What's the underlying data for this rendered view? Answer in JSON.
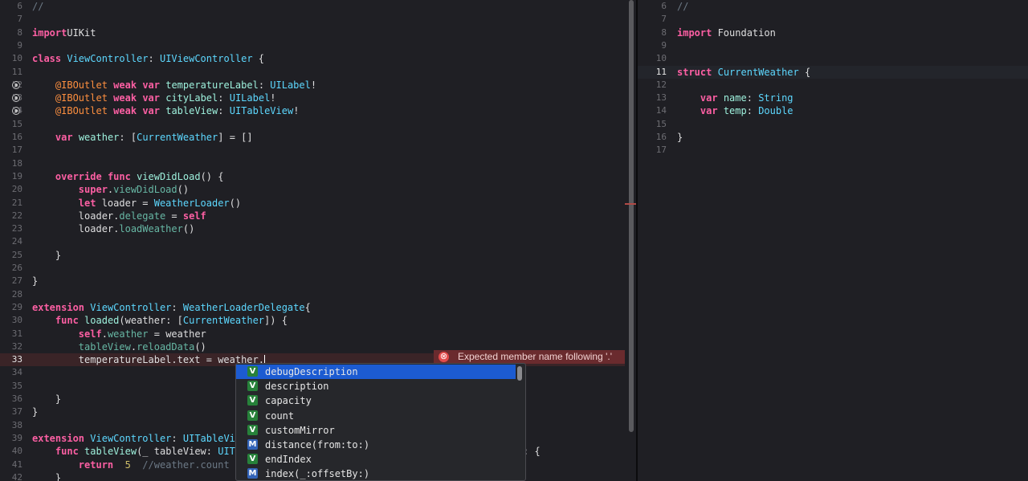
{
  "left_editor": {
    "lines": [
      {
        "n": "6",
        "seg": [
          [
            "cm",
            "//"
          ]
        ]
      },
      {
        "n": "7",
        "seg": []
      },
      {
        "n": "8",
        "seg": [
          [
            "kw",
            "import"
          ],
          [
            "",
            "UIKit"
          ]
        ]
      },
      {
        "n": "9",
        "seg": []
      },
      {
        "n": "10",
        "seg": [
          [
            "kw",
            "class"
          ],
          [
            "",
            ""
          ],
          [
            "tp",
            "ViewController"
          ],
          [
            "",
            ": "
          ],
          [
            "tp",
            "UIViewController"
          ],
          [
            "",
            " {"
          ]
        ]
      },
      {
        "n": "11",
        "seg": []
      },
      {
        "n": "12",
        "bp": true,
        "seg": [
          [
            "",
            "    "
          ],
          [
            "attr",
            "@IBOutlet"
          ],
          [
            "",
            " "
          ],
          [
            "kw",
            "weak"
          ],
          [
            "",
            " "
          ],
          [
            "kw",
            "var"
          ],
          [
            "",
            " "
          ],
          [
            "ut",
            "temperatureLabel"
          ],
          [
            "",
            ": "
          ],
          [
            "tp",
            "UILabel"
          ],
          [
            "",
            "!"
          ]
        ]
      },
      {
        "n": "13",
        "bp": true,
        "seg": [
          [
            "",
            "    "
          ],
          [
            "attr",
            "@IBOutlet"
          ],
          [
            "",
            " "
          ],
          [
            "kw",
            "weak"
          ],
          [
            "",
            " "
          ],
          [
            "kw",
            "var"
          ],
          [
            "",
            " "
          ],
          [
            "ut",
            "cityLabel"
          ],
          [
            "",
            ": "
          ],
          [
            "tp",
            "UILabel"
          ],
          [
            "",
            "!"
          ]
        ]
      },
      {
        "n": "14",
        "bp": true,
        "seg": [
          [
            "",
            "    "
          ],
          [
            "attr",
            "@IBOutlet"
          ],
          [
            "",
            " "
          ],
          [
            "kw",
            "weak"
          ],
          [
            "",
            " "
          ],
          [
            "kw",
            "var"
          ],
          [
            "",
            " "
          ],
          [
            "ut",
            "tableView"
          ],
          [
            "",
            ": "
          ],
          [
            "tp",
            "UITableView"
          ],
          [
            "",
            "!"
          ]
        ]
      },
      {
        "n": "15",
        "seg": []
      },
      {
        "n": "16",
        "seg": [
          [
            "",
            "    "
          ],
          [
            "kw",
            "var"
          ],
          [
            "",
            " "
          ],
          [
            "ut",
            "weather"
          ],
          [
            "",
            ": ["
          ],
          [
            "tp",
            "CurrentWeather"
          ],
          [
            "",
            "] = []"
          ]
        ]
      },
      {
        "n": "17",
        "seg": []
      },
      {
        "n": "18",
        "seg": []
      },
      {
        "n": "19",
        "seg": [
          [
            "",
            "    "
          ],
          [
            "kw",
            "override"
          ],
          [
            "",
            " "
          ],
          [
            "kw",
            "func"
          ],
          [
            "",
            " "
          ],
          [
            "ut",
            "viewDidLoad"
          ],
          [
            "",
            "() {"
          ]
        ]
      },
      {
        "n": "20",
        "seg": [
          [
            "",
            "        "
          ],
          [
            "kw",
            "super"
          ],
          [
            "",
            "."
          ],
          [
            "fn",
            "viewDidLoad"
          ],
          [
            "",
            "()"
          ]
        ]
      },
      {
        "n": "21",
        "seg": [
          [
            "",
            "        "
          ],
          [
            "kw",
            "let"
          ],
          [
            "",
            " loader = "
          ],
          [
            "tp",
            "WeatherLoader"
          ],
          [
            "",
            "()"
          ]
        ]
      },
      {
        "n": "22",
        "seg": [
          [
            "",
            "        loader."
          ],
          [
            "fn",
            "delegate"
          ],
          [
            "",
            " = "
          ],
          [
            "kw",
            "self"
          ]
        ]
      },
      {
        "n": "23",
        "seg": [
          [
            "",
            "        loader."
          ],
          [
            "fn",
            "loadWeather"
          ],
          [
            "",
            "()"
          ]
        ]
      },
      {
        "n": "24",
        "seg": []
      },
      {
        "n": "25",
        "seg": [
          [
            "",
            "    }"
          ]
        ]
      },
      {
        "n": "26",
        "seg": []
      },
      {
        "n": "27",
        "seg": [
          [
            "",
            "}"
          ]
        ]
      },
      {
        "n": "28",
        "seg": []
      },
      {
        "n": "29",
        "seg": [
          [
            "kw",
            "extension"
          ],
          [
            "",
            " "
          ],
          [
            "tp",
            "ViewController"
          ],
          [
            "",
            ": "
          ],
          [
            "tp",
            "WeatherLoaderDelegate"
          ],
          [
            "",
            "{"
          ]
        ]
      },
      {
        "n": "30",
        "seg": [
          [
            "",
            "    "
          ],
          [
            "kw",
            "func"
          ],
          [
            "",
            " "
          ],
          [
            "ut",
            "loaded"
          ],
          [
            "",
            "(weather: ["
          ],
          [
            "tp",
            "CurrentWeather"
          ],
          [
            "",
            "]) {"
          ]
        ]
      },
      {
        "n": "31",
        "seg": [
          [
            "",
            "        "
          ],
          [
            "kw",
            "self"
          ],
          [
            "",
            "."
          ],
          [
            "fn",
            "weather"
          ],
          [
            "",
            " = weather"
          ]
        ]
      },
      {
        "n": "32",
        "seg": [
          [
            "",
            "        "
          ],
          [
            "fn",
            "tableView"
          ],
          [
            "",
            "."
          ],
          [
            "fn",
            "reloadData"
          ],
          [
            "",
            "()"
          ]
        ]
      },
      {
        "n": "33",
        "error": true,
        "caret": true,
        "seg": [
          [
            "",
            "        temperatureLabel.text = weather."
          ]
        ]
      },
      {
        "n": "34",
        "seg": []
      },
      {
        "n": "35",
        "seg": []
      },
      {
        "n": "36",
        "seg": [
          [
            "",
            "    }"
          ]
        ]
      },
      {
        "n": "37",
        "seg": [
          [
            "",
            "}"
          ]
        ]
      },
      {
        "n": "38",
        "seg": []
      },
      {
        "n": "39",
        "seg": [
          [
            "kw",
            "extension"
          ],
          [
            "",
            " "
          ],
          [
            "tp",
            "ViewController"
          ],
          [
            "",
            ": "
          ],
          [
            "tp",
            "UITableVie"
          ]
        ]
      },
      {
        "n": "40",
        "seg": [
          [
            "",
            "    "
          ],
          [
            "kw",
            "func"
          ],
          [
            "",
            " "
          ],
          [
            "ut",
            "tableView"
          ],
          [
            "",
            "(_ tableView: "
          ],
          [
            "tp",
            "UITa"
          ]
        ],
        "tail": ": {"
      },
      {
        "n": "41",
        "seg": [
          [
            "",
            "        "
          ],
          [
            "kw",
            "return"
          ],
          [
            "",
            "  "
          ],
          [
            "num",
            "5"
          ],
          [
            "",
            "  "
          ],
          [
            "cm",
            "//weather.count"
          ]
        ]
      },
      {
        "n": "42",
        "seg": [
          [
            "",
            "    }"
          ]
        ]
      }
    ]
  },
  "right_editor": {
    "lines": [
      {
        "n": "6",
        "seg": [
          [
            "cm",
            "//"
          ]
        ]
      },
      {
        "n": "7",
        "seg": []
      },
      {
        "n": "8",
        "seg": [
          [
            "kw",
            "import"
          ],
          [
            "",
            " Foundation"
          ]
        ]
      },
      {
        "n": "9",
        "seg": []
      },
      {
        "n": "10",
        "seg": []
      },
      {
        "n": "11",
        "current": true,
        "seg": [
          [
            "kw",
            "struct"
          ],
          [
            "",
            " "
          ],
          [
            "tp",
            "CurrentWeather"
          ],
          [
            "",
            " {"
          ]
        ]
      },
      {
        "n": "12",
        "seg": []
      },
      {
        "n": "13",
        "seg": [
          [
            "",
            "    "
          ],
          [
            "kw",
            "var"
          ],
          [
            "",
            " "
          ],
          [
            "ut",
            "name"
          ],
          [
            "",
            ": "
          ],
          [
            "tp",
            "String"
          ]
        ]
      },
      {
        "n": "14",
        "seg": [
          [
            "",
            "    "
          ],
          [
            "kw",
            "var"
          ],
          [
            "",
            " "
          ],
          [
            "ut",
            "temp"
          ],
          [
            "",
            ": "
          ],
          [
            "tp",
            "Double"
          ]
        ]
      },
      {
        "n": "15",
        "seg": []
      },
      {
        "n": "16",
        "seg": [
          [
            "",
            "}"
          ]
        ]
      },
      {
        "n": "17",
        "seg": []
      }
    ]
  },
  "error": {
    "icon": "error-icon",
    "icon_glyph": "⊗",
    "message": "Expected member name following '.'"
  },
  "completion": {
    "items": [
      {
        "kind": "V",
        "label": "debugDescription",
        "selected": true
      },
      {
        "kind": "V",
        "label": "description"
      },
      {
        "kind": "V",
        "label": "capacity"
      },
      {
        "kind": "V",
        "label": "count"
      },
      {
        "kind": "V",
        "label": "customMirror"
      },
      {
        "kind": "M",
        "label": "distance(from:to:)"
      },
      {
        "kind": "V",
        "label": "endIndex"
      },
      {
        "kind": "M",
        "label": "index(_:offsetBy:)"
      }
    ]
  },
  "colors": {
    "background": "#1f1f24",
    "keyword": "#fc5fa3",
    "type": "#5dd8ff",
    "selection": "#1c5bd1",
    "error_banner": "#6a2b2e"
  }
}
